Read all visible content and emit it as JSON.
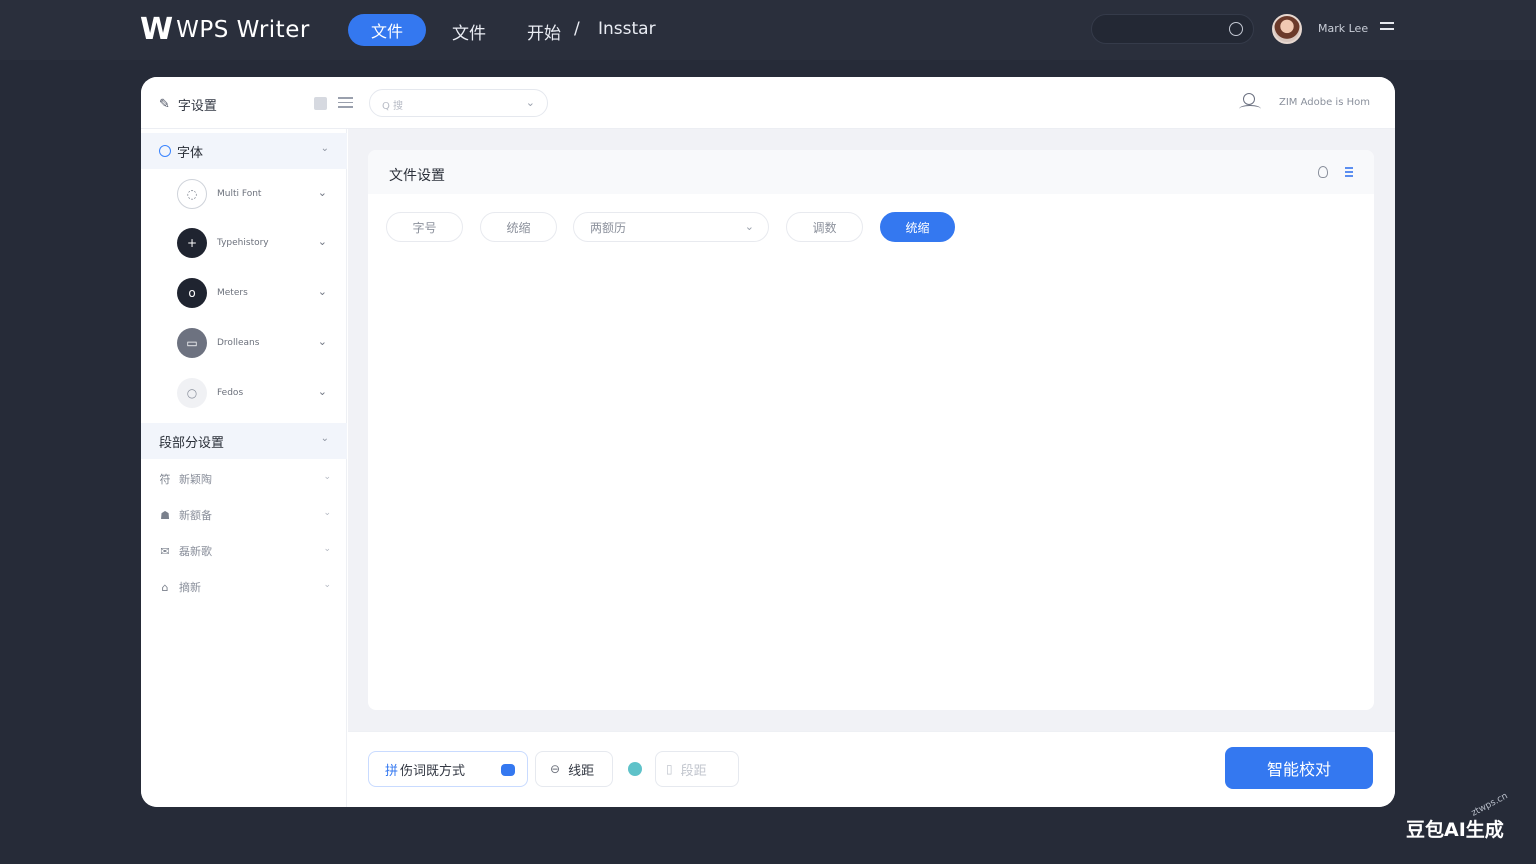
{
  "topbar": {
    "logo_mark": "W",
    "logo_text": "WPS Writer",
    "nav_active": "文件",
    "nav_links": [
      "文件",
      "开始",
      "/",
      "Insstar"
    ],
    "user_name": "Mark Lee"
  },
  "window": {
    "title": "字设置",
    "search_placeholder": "Q 搜",
    "user_text": "ZIM Adobe is Hom"
  },
  "sidebar": {
    "font_group": "字体",
    "items": [
      {
        "label": "Multi Font",
        "icon": "circle-outline-icon"
      },
      {
        "label": "Typehistory",
        "icon": "plus-icon"
      },
      {
        "label": "Meters",
        "icon": "o-icon"
      },
      {
        "label": "Drolleans",
        "icon": "square-icon"
      },
      {
        "label": "Fedos",
        "icon": "dot-icon"
      }
    ],
    "section_group": "段部分设置",
    "subitems": [
      {
        "label": "新颖陶",
        "icon": "符"
      },
      {
        "label": "新额备",
        "icon": "☗"
      },
      {
        "label": "磊新歌",
        "icon": "✉"
      },
      {
        "label": "摘新",
        "icon": "⌂"
      }
    ]
  },
  "card": {
    "title": "文件设置",
    "chips": [
      "字号",
      "统缩",
      "两额历",
      "调数",
      "统缩"
    ]
  },
  "footer": {
    "btn1_prefix": "拼",
    "btn1_label": "伤词既方式",
    "btn2_label": "线距",
    "btn3_label": "段距",
    "primary": "智能校对"
  },
  "watermark": {
    "main": "豆包AI生成",
    "small": "ztwps.cn"
  },
  "colors": {
    "accent": "#3478f0",
    "topbar": "#2a2f3c",
    "teal": "#5ec2c9"
  }
}
